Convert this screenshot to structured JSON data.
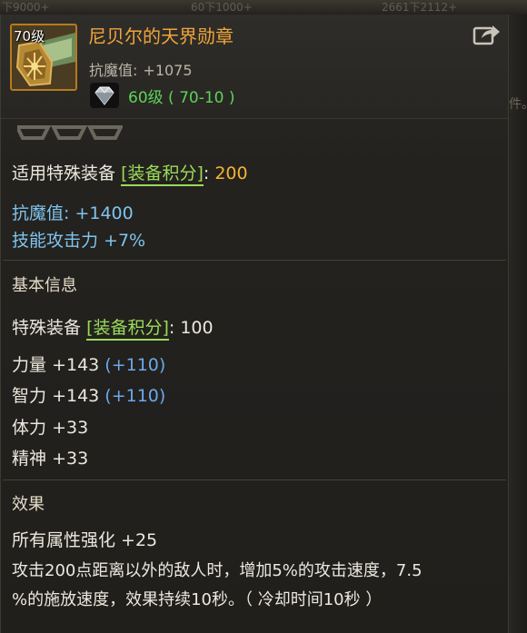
{
  "backdrop": {
    "top_texts": [
      "下9000+",
      "60下1000+",
      "2661下2112+"
    ],
    "right_fragment": "件。"
  },
  "item": {
    "level_tag": "70级",
    "name": "尼贝尔的天界勋章",
    "magic_resist_label": "抗魔值:",
    "magic_resist_value": "+1075",
    "gem_level": "60级",
    "gem_range": "( 70-10 )",
    "share_icon": "share-icon"
  },
  "special_equip": {
    "label": "适用特殊装备",
    "bracket": "[装备积分]",
    "colon": ":",
    "value": "200"
  },
  "bonus": {
    "magic_resist": "抗魔值: +1400",
    "skill_attack": "技能攻击力 +7%"
  },
  "basic_info": {
    "title": "基本信息",
    "special_label": "特殊装备",
    "special_bracket": "[装备积分]",
    "special_colon": ":",
    "special_value": "100",
    "stats": [
      {
        "name": "力量",
        "value": "+143",
        "bonus": "(+110)"
      },
      {
        "name": "智力",
        "value": "+143",
        "bonus": "(+110)"
      },
      {
        "name": "体力",
        "value": "+33",
        "bonus": ""
      },
      {
        "name": "精神",
        "value": "+33",
        "bonus": ""
      }
    ]
  },
  "effect": {
    "title": "效果",
    "line1": "所有属性强化 +25",
    "line2": "攻击200点距离以外的敌人时，增加5%的攻击速度，7.5",
    "line3": "%的施放速度，效果持续10秒。（ 冷却时间10秒 ）"
  },
  "colors": {
    "item_name": "#f0a53a",
    "gem_text": "#5cd35c",
    "bracket": "#9bdb5a",
    "bonus_blue": "#7fc4ef",
    "points_gold": "#f5b332",
    "frame_border": "#b67a1f"
  }
}
